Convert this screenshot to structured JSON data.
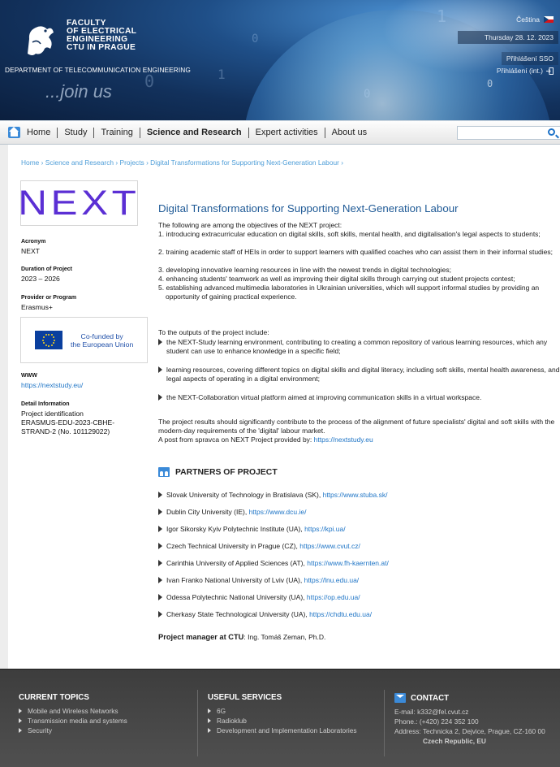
{
  "header": {
    "faculty_lines": [
      "FACULTY",
      "OF ELECTRICAL",
      "ENGINEERING",
      "CTU IN PRAGUE"
    ],
    "department": "DEPARTMENT OF TELECOMMUNICATION ENGINEERING",
    "slogan": "...join us",
    "language": "Čeština",
    "date": "Thursday 28. 12. 2023",
    "login_sso": "Přihlášení SSO",
    "login_int": "Přihlášení (int.)"
  },
  "nav": {
    "items": [
      "Home",
      "Study",
      "Training",
      "Science and Research",
      "Expert activities",
      "About us"
    ],
    "active_index": 3,
    "search_placeholder": ""
  },
  "breadcrumb": "Home › Science and Research › Projects › Digital Transformations for Supporting Next-Generation Labour ›",
  "sidebar": {
    "logo_text": "NEXT",
    "acronym_label": "Acronym",
    "acronym": "NEXT",
    "duration_label": "Duration of Project",
    "duration": "2023 – 2026",
    "provider_label": "Provider or Program",
    "provider": "Erasmus+",
    "eu_text_1": "Co-funded by",
    "eu_text_2": "the European Union",
    "www_label": "WWW",
    "www": "https://nextstudy.eu/",
    "detail_label": "Detail Information",
    "detail_lines": [
      "Project identification",
      "ERASMUS-EDU-2023-CBHE-",
      "STRAND-2 (No. 101129022)"
    ]
  },
  "main": {
    "title": "Digital Transformations for Supporting Next-Generation Labour",
    "intro": "The following are among the objectives of the NEXT project:",
    "objectives": [
      "1. introducing extracurricular education on digital skills, soft skills, mental health, and digitalisation's legal aspects to students;",
      "2. training academic staff of HEIs in order to support learners with qualified coaches who can assist them in their informal studies;",
      "3. developing innovative learning resources in line with the newest trends in digital technologies;",
      "4. enhancing students' teamwork as well as improving their digital skills through carrying out student projects contest;",
      "5. establishing advanced multimedia laboratories in Ukrainian universities, which will support informal studies by providing an opportunity of gaining practical experience."
    ],
    "outputs_intro": "To the outputs of the project include:",
    "outputs": [
      "the NEXT-Study learning environment, contributing to creating a common repository of various learning resources, which any student can use to enhance knowledge in a specific field;",
      "learning resources, covering different topics on digital skills and digital literacy, including soft skills, mental health awareness, and legal aspects of operating in a digital environment;",
      "the NEXT-Collaboration virtual platform aimed at improving communication skills in a virtual workspace."
    ],
    "conclusion": "The project results should significantly contribute to the process of the alignment of future specialists' digital and soft skills with the modern-day requirements of the 'digital' labour market.",
    "post_prefix": "A post from spravca on NEXT Project provided by: ",
    "post_link": "https://nextstudy.eu",
    "partners_title": "PARTNERS OF PROJECT",
    "partners": [
      {
        "name": "Slovak University of Technology in Bratislava (SK), ",
        "url": "https://www.stuba.sk/"
      },
      {
        "name": "Dublin City University (IE), ",
        "url": "https://www.dcu.ie/"
      },
      {
        "name": "Igor Sikorsky Kyiv Polytechnic Institute (UA), ",
        "url": "https://kpi.ua/"
      },
      {
        "name": "Czech Technical University in Prague (CZ), ",
        "url": "https://www.cvut.cz/"
      },
      {
        "name": "Carinthia University of Applied Sciences (AT), ",
        "url": "https://www.fh-kaernten.at/"
      },
      {
        "name": "Ivan Franko National University of Lviv (UA), ",
        "url": "https://lnu.edu.ua/"
      },
      {
        "name": "Odessa Polytechnic National University (UA), ",
        "url": "https://op.edu.ua/"
      },
      {
        "name": "Cherkasy State Technological University (UA), ",
        "url": "https://chdtu.edu.ua/"
      }
    ],
    "manager_label": "Project manager at CTU",
    "manager": ": Ing. Tomáš Zeman, Ph.D."
  },
  "footer": {
    "topics_title": "CURRENT TOPICS",
    "topics": [
      "Mobile and Wireless Networks",
      "Transmission media and systems",
      "Security"
    ],
    "services_title": "USEFUL SERVICES",
    "services": [
      "6G",
      "Radioklub",
      "Development and Implementation Laboratories"
    ],
    "contact_title": "CONTACT",
    "email": "E-mail: k332@fel.cvut.cz",
    "phone": "Phone.: (+420) 224 352 100",
    "address": "Address: Technicka 2, Dejvice, Prague, CZ-160 00",
    "country": "Czech Republic, EU"
  },
  "colors": {
    "accent": "#1f75c6",
    "title": "#1f5a96",
    "logo": "#5b2fd4"
  }
}
